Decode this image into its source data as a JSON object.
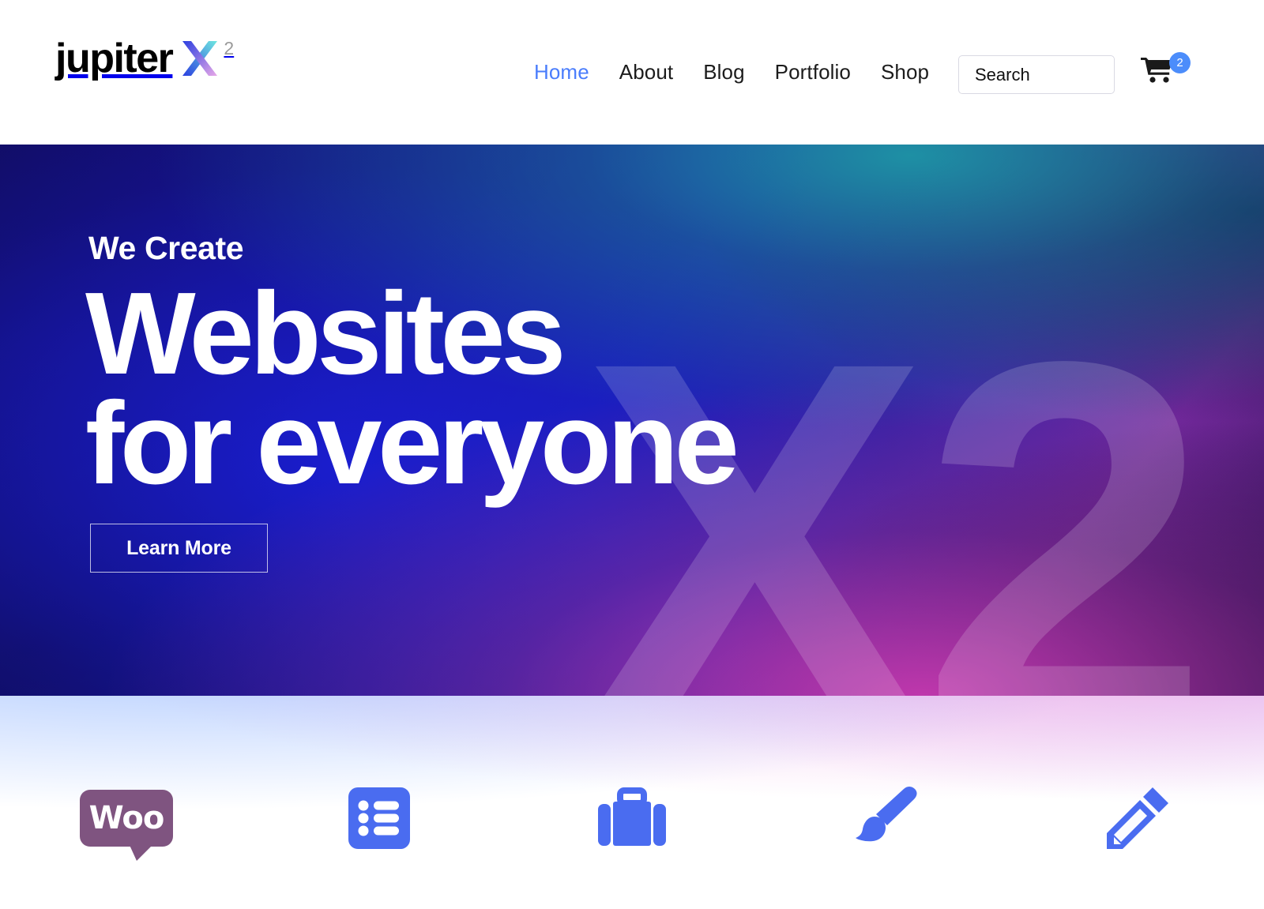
{
  "header": {
    "logo": {
      "word": "jupiter",
      "mark": "X",
      "superscript": "2",
      "mark_gradient_left": "#2b3fe0",
      "mark_gradient_right": "#6fe8e0",
      "mark_gradient_pink": "#e3a6e8"
    },
    "nav": [
      {
        "label": "Home",
        "active": true
      },
      {
        "label": "About",
        "active": false
      },
      {
        "label": "Blog",
        "active": false
      },
      {
        "label": "Portfolio",
        "active": false
      },
      {
        "label": "Shop",
        "active": false
      }
    ],
    "search": {
      "placeholder": "Search",
      "value": ""
    },
    "cart": {
      "icon": "shopping-cart-icon",
      "count": "2",
      "badge_color": "#4c8dfb"
    },
    "active_link_color": "#4a7dfc"
  },
  "hero": {
    "eyebrow": "We Create",
    "title_line1": "Websites",
    "title_line2": "for everyone",
    "cta_label": "Learn More",
    "watermark": "X2"
  },
  "features": [
    {
      "name": "woocommerce",
      "icon": "woocommerce-logo",
      "label": "Woo",
      "color": "#7f5480"
    },
    {
      "name": "list",
      "icon": "list-icon",
      "color": "#4a6cf0"
    },
    {
      "name": "portfolio",
      "icon": "briefcase-icon",
      "color": "#4a6cf0"
    },
    {
      "name": "design",
      "icon": "paintbrush-icon",
      "color": "#4a6cf0"
    },
    {
      "name": "edit",
      "icon": "pencil-icon",
      "color": "#4a6cf0"
    }
  ]
}
